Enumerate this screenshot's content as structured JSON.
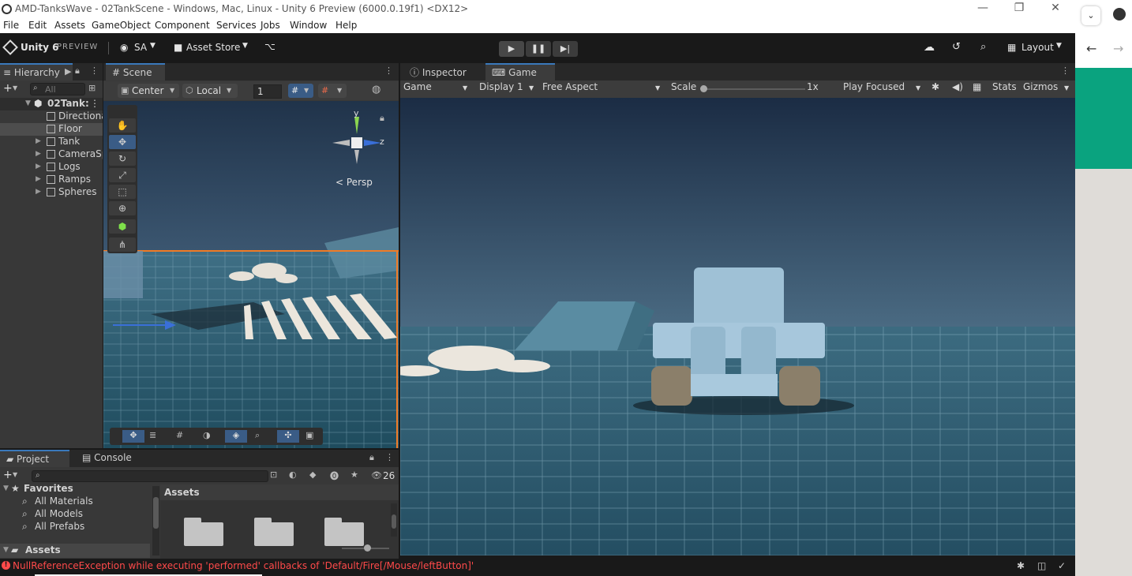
{
  "window": {
    "title": "AMD-TanksWave - 02TankScene - Windows, Mac, Linux - Unity 6 Preview (6000.0.19f1) <DX12>",
    "minimize": "—",
    "maximize": "❐",
    "close": "✕"
  },
  "menu": [
    "File",
    "Edit",
    "Assets",
    "GameObject",
    "Component",
    "Services",
    "Jobs",
    "Window",
    "Help"
  ],
  "toolbar": {
    "brand": "Unity 6",
    "brand_badge": "PREVIEW",
    "account": "SA",
    "asset_store": "Asset Store",
    "layout": "Layout"
  },
  "hierarchy": {
    "tab": "Hierarchy",
    "search_placeholder": "All",
    "scene": "02Tank:",
    "items": [
      {
        "name": "Directiona",
        "expandable": false
      },
      {
        "name": "Floor",
        "expandable": false,
        "selected": true
      },
      {
        "name": "Tank",
        "expandable": true
      },
      {
        "name": "CameraSp",
        "expandable": true
      },
      {
        "name": "Logs",
        "expandable": true
      },
      {
        "name": "Ramps",
        "expandable": true
      },
      {
        "name": "Spheres",
        "expandable": true
      }
    ]
  },
  "scene": {
    "tab": "Scene",
    "pivot": "Center",
    "space": "Local",
    "grid_size": "1",
    "gizmo_y": "y",
    "gizmo_z": "z",
    "projection": "Persp"
  },
  "inspector": {
    "tab": "Inspector"
  },
  "game": {
    "tab": "Game",
    "mode": "Game",
    "display": "Display 1",
    "aspect": "Free Aspect",
    "scale_label": "Scale",
    "scale_value": "1x",
    "play_mode": "Play Focused",
    "stats": "Stats",
    "gizmos": "Gizmos"
  },
  "project": {
    "tab": "Project",
    "console_tab": "Console",
    "count": "26",
    "favorites": "Favorites",
    "favorite_items": [
      "All Materials",
      "All Models",
      "All Prefabs"
    ],
    "assets_root": "Assets",
    "assets_header": "Assets"
  },
  "status": {
    "error": "NullReferenceException while executing 'performed' callbacks of 'Default/Fire[/Mouse/leftButton]'"
  },
  "colors": {
    "accent": "#3a79bb",
    "selection_orange": "#f07b26",
    "error_red": "#ff4a4a",
    "browser_green": "#0aa37f"
  }
}
